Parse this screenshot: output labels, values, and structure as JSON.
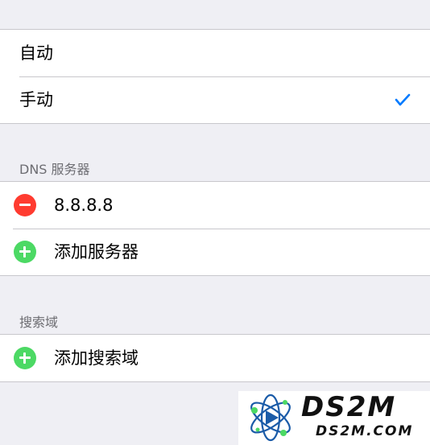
{
  "mode": {
    "automatic_label": "自动",
    "manual_label": "手动",
    "selected": "manual"
  },
  "dns": {
    "header": "DNS 服务器",
    "servers": [
      "8.8.8.8"
    ],
    "add_label": "添加服务器"
  },
  "search_domains": {
    "header": "搜索域",
    "add_label": "添加搜索域"
  },
  "watermark": {
    "title": "DS2M",
    "subtitle": "DS2M.COM"
  },
  "icons": {
    "checkmark": "checkmark-icon",
    "remove": "minus-circle-icon",
    "add": "plus-circle-icon"
  },
  "colors": {
    "background": "#efeff4",
    "accent": "#007aff",
    "remove": "#ff3b30",
    "add": "#4cd964",
    "section_header": "#6d6d72"
  }
}
